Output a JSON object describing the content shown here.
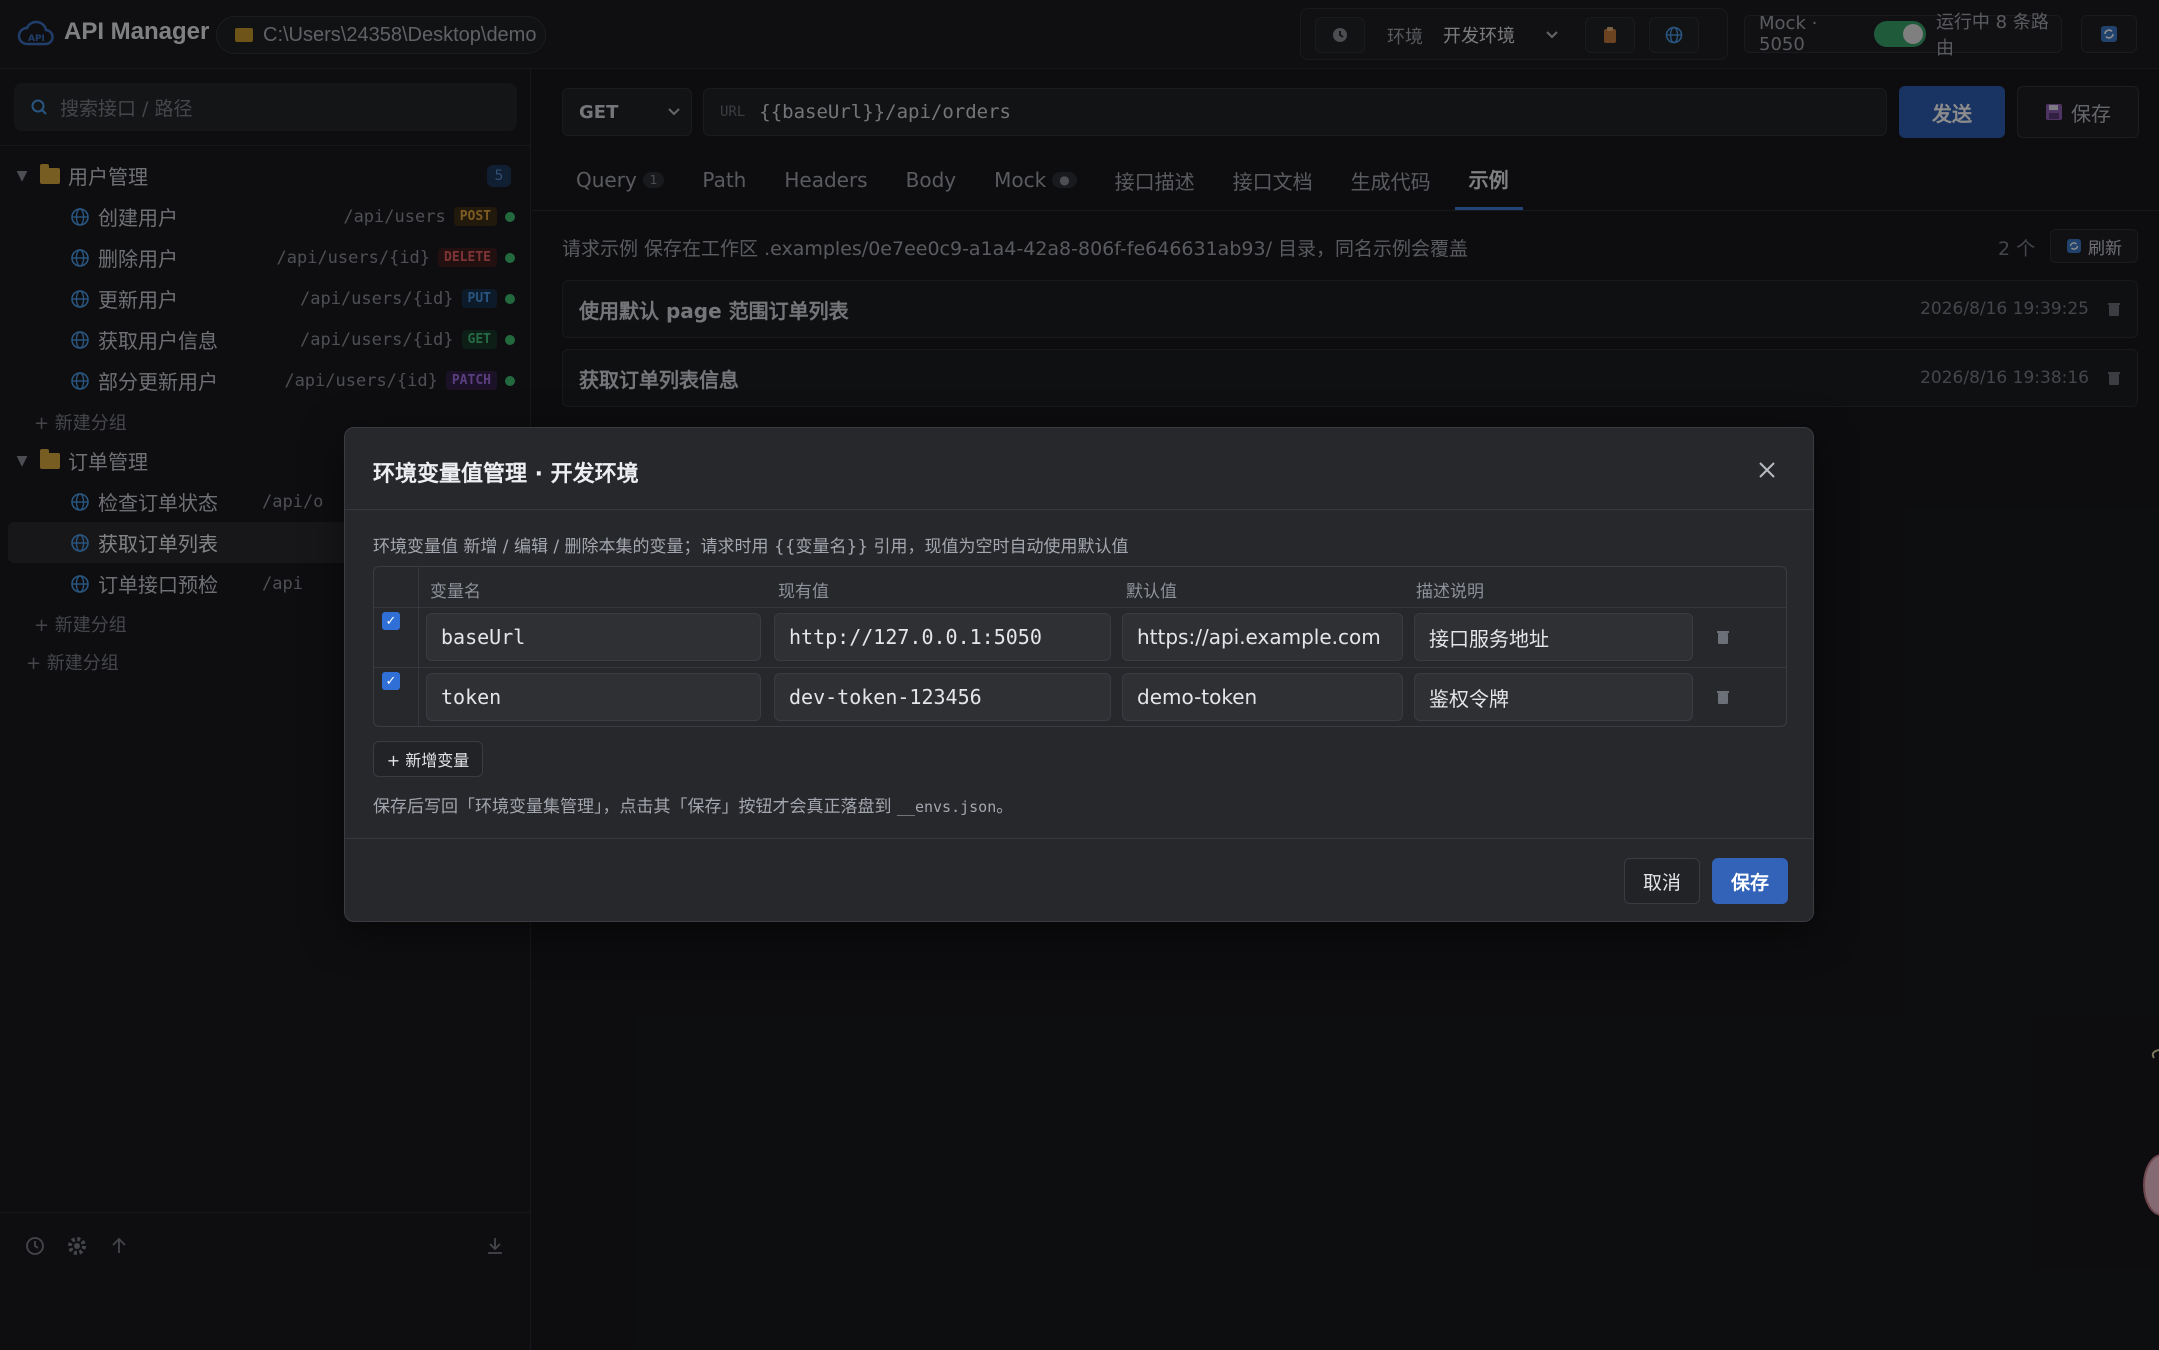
{
  "app": {
    "title": "API Manager",
    "workspace_path": "C:\\Users\\24358\\Desktop\\demo"
  },
  "topbar": {
    "env_label": "环境",
    "env_selected": "开发环境",
    "mock_label": "Mock · 5050",
    "mock_enabled": true,
    "mock_status": "运行中 8 条路由"
  },
  "sidebar": {
    "search_placeholder": "搜索接口 / 路径",
    "groups": [
      {
        "name": "用户管理",
        "count": "5",
        "expanded": true,
        "items": [
          {
            "name": "创建用户",
            "path": "/api/users",
            "method": "POST"
          },
          {
            "name": "删除用户",
            "path": "/api/users/{id}",
            "method": "DELETE"
          },
          {
            "name": "更新用户",
            "path": "/api/users/{id}",
            "method": "PUT"
          },
          {
            "name": "获取用户信息",
            "path": "/api/users/{id}",
            "method": "GET"
          },
          {
            "name": "部分更新用户",
            "path": "/api/users/{id}",
            "method": "PATCH"
          }
        ],
        "new_subgroup": "+ 新建分组"
      },
      {
        "name": "订单管理",
        "expanded": true,
        "items": [
          {
            "name": "检查订单状态",
            "path": "/api/o"
          },
          {
            "name": "获取订单列表",
            "path": "",
            "selected": true
          },
          {
            "name": "订单接口预检",
            "path": "/api"
          }
        ],
        "new_subgroup": "+ 新建分组"
      }
    ],
    "new_group": "+ 新建分组"
  },
  "request": {
    "method": "GET",
    "url_label": "URL",
    "url": "{{baseUrl}}/api/orders",
    "send_label": "发送",
    "save_label": "保存"
  },
  "tabs": [
    {
      "label": "Query",
      "badge": "1"
    },
    {
      "label": "Path"
    },
    {
      "label": "Headers"
    },
    {
      "label": "Body"
    },
    {
      "label": "Mock",
      "badge": "●"
    },
    {
      "label": "接口描述"
    },
    {
      "label": "接口文档"
    },
    {
      "label": "生成代码"
    },
    {
      "label": "示例",
      "active": true
    }
  ],
  "examples": {
    "note": "请求示例 保存在工作区 .examples/0e7ee0c9-a1a4-42a8-806f-fe646631ab93/ 目录，同名示例会覆盖",
    "count": "2 个",
    "refresh_label": "刷新",
    "items": [
      {
        "title": "使用默认 page 范围订单列表",
        "time": "2026/8/16 19:39:25"
      },
      {
        "title": "获取订单列表信息",
        "time": "2026/8/16 19:38:16"
      }
    ]
  },
  "modal": {
    "title": "环境变量值管理 · 开发环境",
    "hint": "环境变量值  新增 / 编辑 / 删除本集的变量；请求时用 {{变量名}} 引用，现值为空时自动使用默认值",
    "columns": [
      "变量名",
      "现有值",
      "默认值",
      "描述说明"
    ],
    "rows": [
      {
        "enabled": true,
        "name": "baseUrl",
        "current": "http://127.0.0.1:5050",
        "default": "https://api.example.com",
        "desc": "接口服务地址"
      },
      {
        "enabled": true,
        "name": "token",
        "current": "dev-token-123456",
        "default": "demo-token",
        "desc": "鉴权令牌"
      }
    ],
    "add_label": "+ 新增变量",
    "footer_note_prefix": "保存后写回「环境变量集管理」，点击其「保存」按钮才会真正落盘到 ",
    "footer_note_file": "__envs.json",
    "footer_note_suffix": "。",
    "cancel_label": "取消",
    "save_label": "保存"
  }
}
